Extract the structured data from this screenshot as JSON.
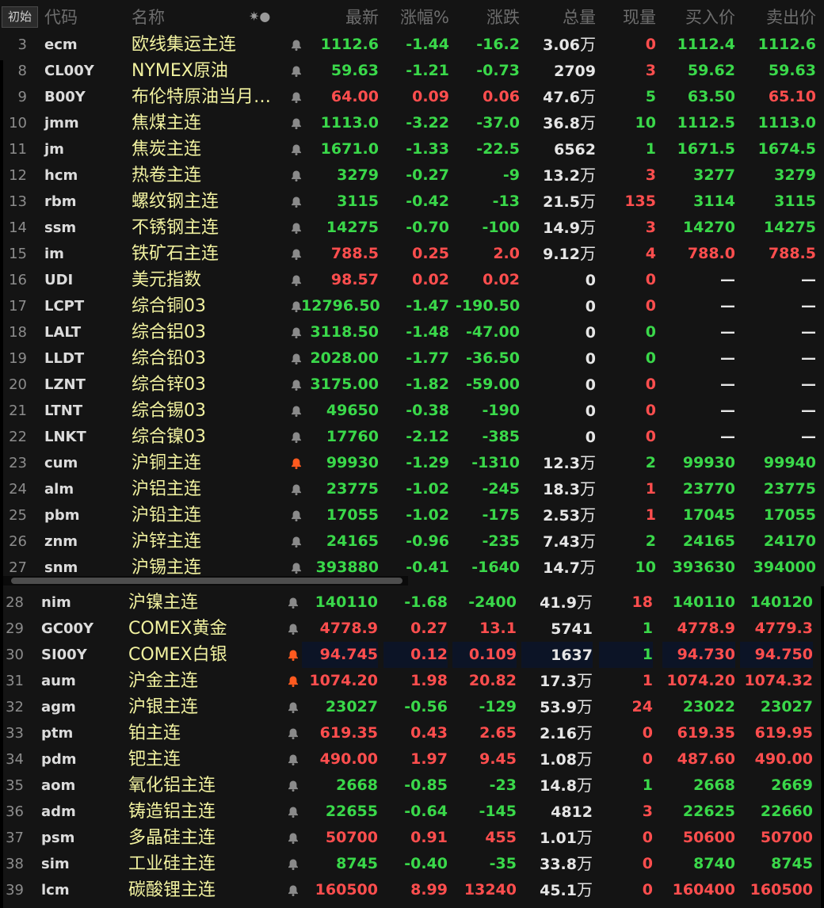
{
  "header": {
    "init_label": "初始",
    "code": "代码",
    "name": "名称",
    "icons": "✷●",
    "last": "最新",
    "pct": "涨幅%",
    "chg": "涨跌",
    "vol": "总量",
    "cur": "现量",
    "bid": "买入价",
    "ask": "卖出价"
  },
  "bell_colors": {
    "gray": "#8a8a8a",
    "orange": "#ff5a1f"
  },
  "rows_top": [
    {
      "n": "3",
      "code": "ecm",
      "name": "欧线集运主连",
      "bell": "gray",
      "last": "1112.6",
      "pct": "-1.44",
      "chg": "-16.2",
      "vol": "3.06",
      "unit": "万",
      "cur": "0",
      "bid": "1112.4",
      "ask": "1112.6",
      "lc": "g",
      "pc": "g",
      "cc": "g",
      "curc": "rd",
      "bc": "g",
      "ac": "g"
    },
    {
      "n": "8",
      "code": "CL00Y",
      "name": "NYMEX原油",
      "bell": "gray",
      "last": "59.63",
      "pct": "-1.21",
      "chg": "-0.73",
      "vol": "2709",
      "unit": "",
      "cur": "3",
      "bid": "59.62",
      "ask": "59.63",
      "lc": "g",
      "pc": "g",
      "cc": "g",
      "curc": "rd",
      "bc": "g",
      "ac": "g"
    },
    {
      "n": "9",
      "code": "B00Y",
      "name": "布伦特原油当月…",
      "bell": "gray",
      "last": "64.00",
      "pct": "0.09",
      "chg": "0.06",
      "vol": "47.6",
      "unit": "万",
      "cur": "5",
      "bid": "63.50",
      "ask": "65.10",
      "lc": "rd",
      "pc": "rd",
      "cc": "rd",
      "curc": "g",
      "bc": "g",
      "ac": "rd"
    },
    {
      "n": "10",
      "code": "jmm",
      "name": "焦煤主连",
      "bell": "gray",
      "last": "1113.0",
      "pct": "-3.22",
      "chg": "-37.0",
      "vol": "36.8",
      "unit": "万",
      "cur": "10",
      "bid": "1112.5",
      "ask": "1113.0",
      "lc": "g",
      "pc": "g",
      "cc": "g",
      "curc": "g",
      "bc": "g",
      "ac": "g"
    },
    {
      "n": "11",
      "code": "jm",
      "name": "焦炭主连",
      "bell": "gray",
      "last": "1671.0",
      "pct": "-1.33",
      "chg": "-22.5",
      "vol": "6562",
      "unit": "",
      "cur": "1",
      "bid": "1671.5",
      "ask": "1674.5",
      "lc": "g",
      "pc": "g",
      "cc": "g",
      "curc": "g",
      "bc": "g",
      "ac": "g"
    },
    {
      "n": "12",
      "code": "hcm",
      "name": "热卷主连",
      "bell": "gray",
      "last": "3279",
      "pct": "-0.27",
      "chg": "-9",
      "vol": "13.2",
      "unit": "万",
      "cur": "3",
      "bid": "3277",
      "ask": "3279",
      "lc": "g",
      "pc": "g",
      "cc": "g",
      "curc": "rd",
      "bc": "g",
      "ac": "g"
    },
    {
      "n": "13",
      "code": "rbm",
      "name": "螺纹钢主连",
      "bell": "gray",
      "last": "3115",
      "pct": "-0.42",
      "chg": "-13",
      "vol": "21.5",
      "unit": "万",
      "cur": "135",
      "bid": "3114",
      "ask": "3115",
      "lc": "g",
      "pc": "g",
      "cc": "g",
      "curc": "rd",
      "bc": "g",
      "ac": "g"
    },
    {
      "n": "14",
      "code": "ssm",
      "name": "不锈钢主连",
      "bell": "gray",
      "last": "14275",
      "pct": "-0.70",
      "chg": "-100",
      "vol": "14.9",
      "unit": "万",
      "cur": "3",
      "bid": "14270",
      "ask": "14275",
      "lc": "g",
      "pc": "g",
      "cc": "g",
      "curc": "rd",
      "bc": "g",
      "ac": "g"
    },
    {
      "n": "15",
      "code": "im",
      "name": "铁矿石主连",
      "bell": "gray",
      "last": "788.5",
      "pct": "0.25",
      "chg": "2.0",
      "vol": "9.12",
      "unit": "万",
      "cur": "4",
      "bid": "788.0",
      "ask": "788.5",
      "lc": "rd",
      "pc": "rd",
      "cc": "rd",
      "curc": "rd",
      "bc": "rd",
      "ac": "rd"
    },
    {
      "n": "16",
      "code": "UDI",
      "name": "美元指数",
      "bell": "gray",
      "last": "98.57",
      "pct": "0.02",
      "chg": "0.02",
      "vol": "0",
      "unit": "",
      "cur": "0",
      "bid": "—",
      "ask": "—",
      "lc": "rd",
      "pc": "rd",
      "cc": "rd",
      "curc": "rd",
      "bc": "w",
      "ac": "w"
    },
    {
      "n": "17",
      "code": "LCPT",
      "name": "综合铜03",
      "bell": "gray",
      "last": "12796.50",
      "pct": "-1.47",
      "chg": "-190.50",
      "vol": "0",
      "unit": "",
      "cur": "0",
      "bid": "—",
      "ask": "—",
      "lc": "g",
      "pc": "g",
      "cc": "g",
      "curc": "rd",
      "bc": "w",
      "ac": "w"
    },
    {
      "n": "18",
      "code": "LALT",
      "name": "综合铝03",
      "bell": "gray",
      "last": "3118.50",
      "pct": "-1.48",
      "chg": "-47.00",
      "vol": "0",
      "unit": "",
      "cur": "0",
      "bid": "—",
      "ask": "—",
      "lc": "g",
      "pc": "g",
      "cc": "g",
      "curc": "g",
      "bc": "w",
      "ac": "w"
    },
    {
      "n": "19",
      "code": "LLDT",
      "name": "综合铅03",
      "bell": "gray",
      "last": "2028.00",
      "pct": "-1.77",
      "chg": "-36.50",
      "vol": "0",
      "unit": "",
      "cur": "0",
      "bid": "—",
      "ask": "—",
      "lc": "g",
      "pc": "g",
      "cc": "g",
      "curc": "g",
      "bc": "w",
      "ac": "w"
    },
    {
      "n": "20",
      "code": "LZNT",
      "name": "综合锌03",
      "bell": "gray",
      "last": "3175.00",
      "pct": "-1.82",
      "chg": "-59.00",
      "vol": "0",
      "unit": "",
      "cur": "0",
      "bid": "—",
      "ask": "—",
      "lc": "g",
      "pc": "g",
      "cc": "g",
      "curc": "rd",
      "bc": "w",
      "ac": "w"
    },
    {
      "n": "21",
      "code": "LTNT",
      "name": "综合锡03",
      "bell": "gray",
      "last": "49650",
      "pct": "-0.38",
      "chg": "-190",
      "vol": "0",
      "unit": "",
      "cur": "0",
      "bid": "—",
      "ask": "—",
      "lc": "g",
      "pc": "g",
      "cc": "g",
      "curc": "rd",
      "bc": "w",
      "ac": "w"
    },
    {
      "n": "22",
      "code": "LNKT",
      "name": "综合镍03",
      "bell": "gray",
      "last": "17760",
      "pct": "-2.12",
      "chg": "-385",
      "vol": "0",
      "unit": "",
      "cur": "0",
      "bid": "—",
      "ask": "—",
      "lc": "g",
      "pc": "g",
      "cc": "g",
      "curc": "rd",
      "bc": "w",
      "ac": "w"
    },
    {
      "n": "23",
      "code": "cum",
      "name": "沪铜主连",
      "bell": "orange",
      "last": "99930",
      "pct": "-1.29",
      "chg": "-1310",
      "vol": "12.3",
      "unit": "万",
      "cur": "2",
      "bid": "99930",
      "ask": "99940",
      "lc": "g",
      "pc": "g",
      "cc": "g",
      "curc": "g",
      "bc": "g",
      "ac": "g"
    },
    {
      "n": "24",
      "code": "alm",
      "name": "沪铝主连",
      "bell": "gray",
      "last": "23775",
      "pct": "-1.02",
      "chg": "-245",
      "vol": "18.3",
      "unit": "万",
      "cur": "1",
      "bid": "23770",
      "ask": "23775",
      "lc": "g",
      "pc": "g",
      "cc": "g",
      "curc": "rd",
      "bc": "g",
      "ac": "g"
    },
    {
      "n": "25",
      "code": "pbm",
      "name": "沪铅主连",
      "bell": "gray",
      "last": "17055",
      "pct": "-1.02",
      "chg": "-175",
      "vol": "2.53",
      "unit": "万",
      "cur": "1",
      "bid": "17045",
      "ask": "17055",
      "lc": "g",
      "pc": "g",
      "cc": "g",
      "curc": "rd",
      "bc": "g",
      "ac": "g"
    },
    {
      "n": "26",
      "code": "znm",
      "name": "沪锌主连",
      "bell": "gray",
      "last": "24165",
      "pct": "-0.96",
      "chg": "-235",
      "vol": "7.43",
      "unit": "万",
      "cur": "2",
      "bid": "24165",
      "ask": "24170",
      "lc": "g",
      "pc": "g",
      "cc": "g",
      "curc": "g",
      "bc": "g",
      "ac": "g"
    },
    {
      "n": "27",
      "code": "snm",
      "name": "沪锡主连",
      "bell": "gray",
      "last": "393880",
      "pct": "-0.41",
      "chg": "-1640",
      "vol": "14.7",
      "unit": "万",
      "cur": "10",
      "bid": "393630",
      "ask": "394000",
      "lc": "g",
      "pc": "g",
      "cc": "g",
      "curc": "g",
      "bc": "g",
      "ac": "g"
    }
  ],
  "rows_bottom": [
    {
      "n": "28",
      "code": "nim",
      "name": "沪镍主连",
      "bell": "gray",
      "last": "140110",
      "pct": "-1.68",
      "chg": "-2400",
      "vol": "41.9",
      "unit": "万",
      "cur": "18",
      "bid": "140110",
      "ask": "140120",
      "lc": "g",
      "pc": "g",
      "cc": "g",
      "curc": "rd",
      "bc": "g",
      "ac": "g"
    },
    {
      "n": "29",
      "code": "GC00Y",
      "name": "COMEX黄金",
      "bell": "gray",
      "last": "4778.9",
      "pct": "0.27",
      "chg": "13.1",
      "vol": "5741",
      "unit": "",
      "cur": "1",
      "bid": "4778.9",
      "ask": "4779.3",
      "lc": "rd",
      "pc": "rd",
      "cc": "rd",
      "curc": "g",
      "bc": "rd",
      "ac": "rd"
    },
    {
      "n": "30",
      "code": "SI00Y",
      "name": "COMEX白银",
      "bell": "orange",
      "last": "94.745",
      "pct": "0.12",
      "chg": "0.109",
      "vol": "1637",
      "unit": "",
      "cur": "1",
      "bid": "94.730",
      "ask": "94.750",
      "lc": "rd",
      "pc": "rd",
      "cc": "rd",
      "curc": "g",
      "bc": "rd",
      "ac": "rd",
      "hl": true
    },
    {
      "n": "31",
      "code": "aum",
      "name": "沪金主连",
      "bell": "orange",
      "last": "1074.20",
      "pct": "1.98",
      "chg": "20.82",
      "vol": "17.3",
      "unit": "万",
      "cur": "1",
      "bid": "1074.20",
      "ask": "1074.32",
      "lc": "rd",
      "pc": "rd",
      "cc": "rd",
      "curc": "rd",
      "bc": "rd",
      "ac": "rd"
    },
    {
      "n": "32",
      "code": "agm",
      "name": "沪银主连",
      "bell": "gray",
      "last": "23027",
      "pct": "-0.56",
      "chg": "-129",
      "vol": "53.9",
      "unit": "万",
      "cur": "24",
      "bid": "23022",
      "ask": "23027",
      "lc": "g",
      "pc": "g",
      "cc": "g",
      "curc": "rd",
      "bc": "g",
      "ac": "g"
    },
    {
      "n": "33",
      "code": "ptm",
      "name": "铂主连",
      "bell": "gray",
      "last": "619.35",
      "pct": "0.43",
      "chg": "2.65",
      "vol": "2.16",
      "unit": "万",
      "cur": "0",
      "bid": "619.35",
      "ask": "619.95",
      "lc": "rd",
      "pc": "rd",
      "cc": "rd",
      "curc": "rd",
      "bc": "rd",
      "ac": "rd"
    },
    {
      "n": "34",
      "code": "pdm",
      "name": "钯主连",
      "bell": "gray",
      "last": "490.00",
      "pct": "1.97",
      "chg": "9.45",
      "vol": "1.08",
      "unit": "万",
      "cur": "0",
      "bid": "487.60",
      "ask": "490.00",
      "lc": "rd",
      "pc": "rd",
      "cc": "rd",
      "curc": "rd",
      "bc": "rd",
      "ac": "rd"
    },
    {
      "n": "35",
      "code": "aom",
      "name": "氧化铝主连",
      "bell": "gray",
      "last": "2668",
      "pct": "-0.85",
      "chg": "-23",
      "vol": "14.8",
      "unit": "万",
      "cur": "1",
      "bid": "2668",
      "ask": "2669",
      "lc": "g",
      "pc": "g",
      "cc": "g",
      "curc": "g",
      "bc": "g",
      "ac": "g"
    },
    {
      "n": "36",
      "code": "adm",
      "name": "铸造铝主连",
      "bell": "gray",
      "last": "22655",
      "pct": "-0.64",
      "chg": "-145",
      "vol": "4812",
      "unit": "",
      "cur": "3",
      "bid": "22625",
      "ask": "22660",
      "lc": "g",
      "pc": "g",
      "cc": "g",
      "curc": "rd",
      "bc": "g",
      "ac": "g"
    },
    {
      "n": "37",
      "code": "psm",
      "name": "多晶硅主连",
      "bell": "gray",
      "last": "50700",
      "pct": "0.91",
      "chg": "455",
      "vol": "1.01",
      "unit": "万",
      "cur": "0",
      "bid": "50600",
      "ask": "50700",
      "lc": "rd",
      "pc": "rd",
      "cc": "rd",
      "curc": "rd",
      "bc": "rd",
      "ac": "rd"
    },
    {
      "n": "38",
      "code": "sim",
      "name": "工业硅主连",
      "bell": "gray",
      "last": "8745",
      "pct": "-0.40",
      "chg": "-35",
      "vol": "33.8",
      "unit": "万",
      "cur": "0",
      "bid": "8740",
      "ask": "8745",
      "lc": "g",
      "pc": "g",
      "cc": "g",
      "curc": "rd",
      "bc": "g",
      "ac": "g"
    },
    {
      "n": "39",
      "code": "lcm",
      "name": "碳酸锂主连",
      "bell": "gray",
      "last": "160500",
      "pct": "8.99",
      "chg": "13240",
      "vol": "45.1",
      "unit": "万",
      "cur": "0",
      "bid": "160400",
      "ask": "160500",
      "lc": "rd",
      "pc": "rd",
      "cc": "rd",
      "curc": "rd",
      "bc": "rd",
      "ac": "rd"
    }
  ]
}
